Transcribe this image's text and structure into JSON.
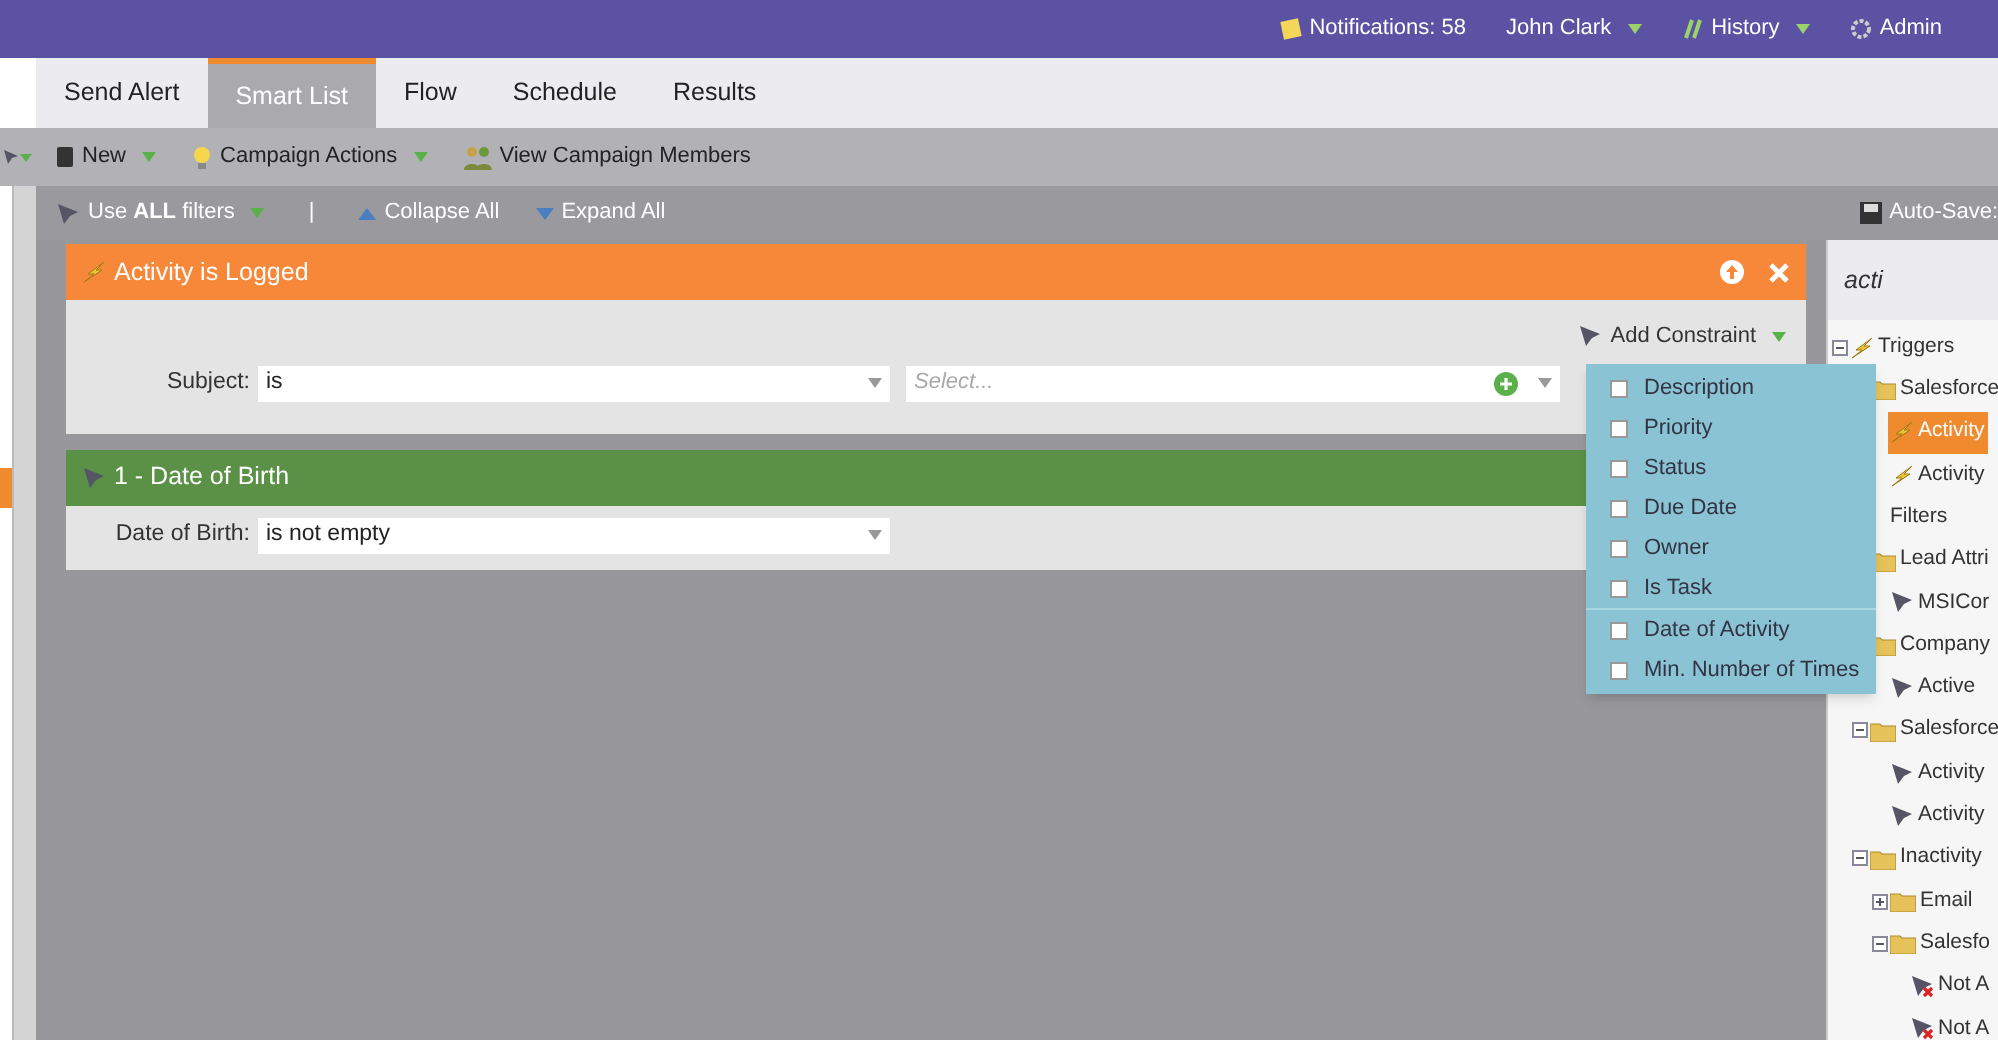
{
  "top_bar": {
    "items": [
      {
        "kind": "notifications",
        "label": "Notifications: 58",
        "caret": false
      },
      {
        "kind": "user",
        "label": "John Clark",
        "caret": true
      },
      {
        "kind": "history",
        "label": "History",
        "caret": true
      },
      {
        "kind": "admin",
        "label": "Admin",
        "caret": false
      }
    ]
  },
  "tabs": [
    {
      "label": "Send Alert",
      "selected": false
    },
    {
      "label": "Smart List",
      "selected": true
    },
    {
      "label": "Flow",
      "selected": false
    },
    {
      "label": "Schedule",
      "selected": false
    },
    {
      "label": "Results",
      "selected": false
    }
  ],
  "toolbar": [
    {
      "kind": "new",
      "label": "New",
      "caret": true
    },
    {
      "kind": "actions",
      "label": "Campaign Actions",
      "caret": true
    },
    {
      "kind": "members",
      "label": "View Campaign Members",
      "caret": false
    }
  ],
  "filter_bar": {
    "use_filters": {
      "before": "Use ",
      "bold": "ALL",
      "after": " filters"
    },
    "separator": "|",
    "collapse": "Collapse All",
    "expand": "Expand All",
    "autosave": "Auto-Save:"
  },
  "filters": [
    {
      "kind": "trigger",
      "title": "Activity is Logged",
      "add_constraint": "Add Constraint",
      "fields": [
        {
          "label": "Subject:",
          "operator": "is",
          "value_placeholder": "Select..."
        }
      ]
    },
    {
      "kind": "filter",
      "title": "1 - Date of Birth",
      "fields": [
        {
          "label": "Date of Birth:",
          "operator": "is not empty"
        }
      ]
    }
  ],
  "constraint_menu": {
    "sections": [
      {
        "items": [
          {
            "label": "Description",
            "checked": false
          },
          {
            "label": "Priority",
            "checked": false
          },
          {
            "label": "Status",
            "checked": false
          },
          {
            "label": "Due Date",
            "checked": false
          },
          {
            "label": "Owner",
            "checked": false
          },
          {
            "label": "Is Task",
            "checked": false
          }
        ]
      },
      {
        "items": [
          {
            "label": "Date of Activity",
            "checked": false
          },
          {
            "label": "Min. Number of Times",
            "checked": false
          }
        ]
      }
    ]
  },
  "palette": {
    "search": "acti",
    "tree": [
      {
        "label": "Triggers",
        "kind": "trigger",
        "expanded": true,
        "selected": false,
        "children": [
          {
            "label": "Salesforce",
            "kind": "folder",
            "selected": false,
            "children": [
              {
                "label": "Activity",
                "kind": "trigger",
                "selected": true
              },
              {
                "label": "Activity",
                "kind": "trigger",
                "selected": false
              }
            ]
          }
        ]
      },
      {
        "label": "Filters",
        "kind": "group",
        "selected": false,
        "children": [
          {
            "label": "Lead Attri",
            "kind": "folder",
            "selected": false,
            "children": [
              {
                "label": "MSICor",
                "kind": "filter",
                "selected": false
              }
            ]
          },
          {
            "label": "Company",
            "kind": "folder",
            "selected": false,
            "children": [
              {
                "label": "Active",
                "kind": "filter",
                "selected": false
              }
            ]
          },
          {
            "label": "Salesforce",
            "kind": "folder",
            "expanded": true,
            "selected": false,
            "children": [
              {
                "label": "Activity",
                "kind": "filter",
                "selected": false
              },
              {
                "label": "Activity",
                "kind": "filter",
                "selected": false
              }
            ]
          },
          {
            "label": "Inactivity",
            "kind": "folder",
            "expanded": true,
            "selected": false,
            "children": [
              {
                "label": "Email",
                "kind": "folder",
                "expanded": false,
                "selected": false
              },
              {
                "label": "Salesfo",
                "kind": "folder",
                "expanded": true,
                "selected": false,
                "children": [
                  {
                    "label": "Not A",
                    "kind": "negated_filter",
                    "selected": false
                  },
                  {
                    "label": "Not A",
                    "kind": "negated_filter",
                    "selected": false
                  }
                ]
              }
            ]
          }
        ]
      }
    ]
  }
}
